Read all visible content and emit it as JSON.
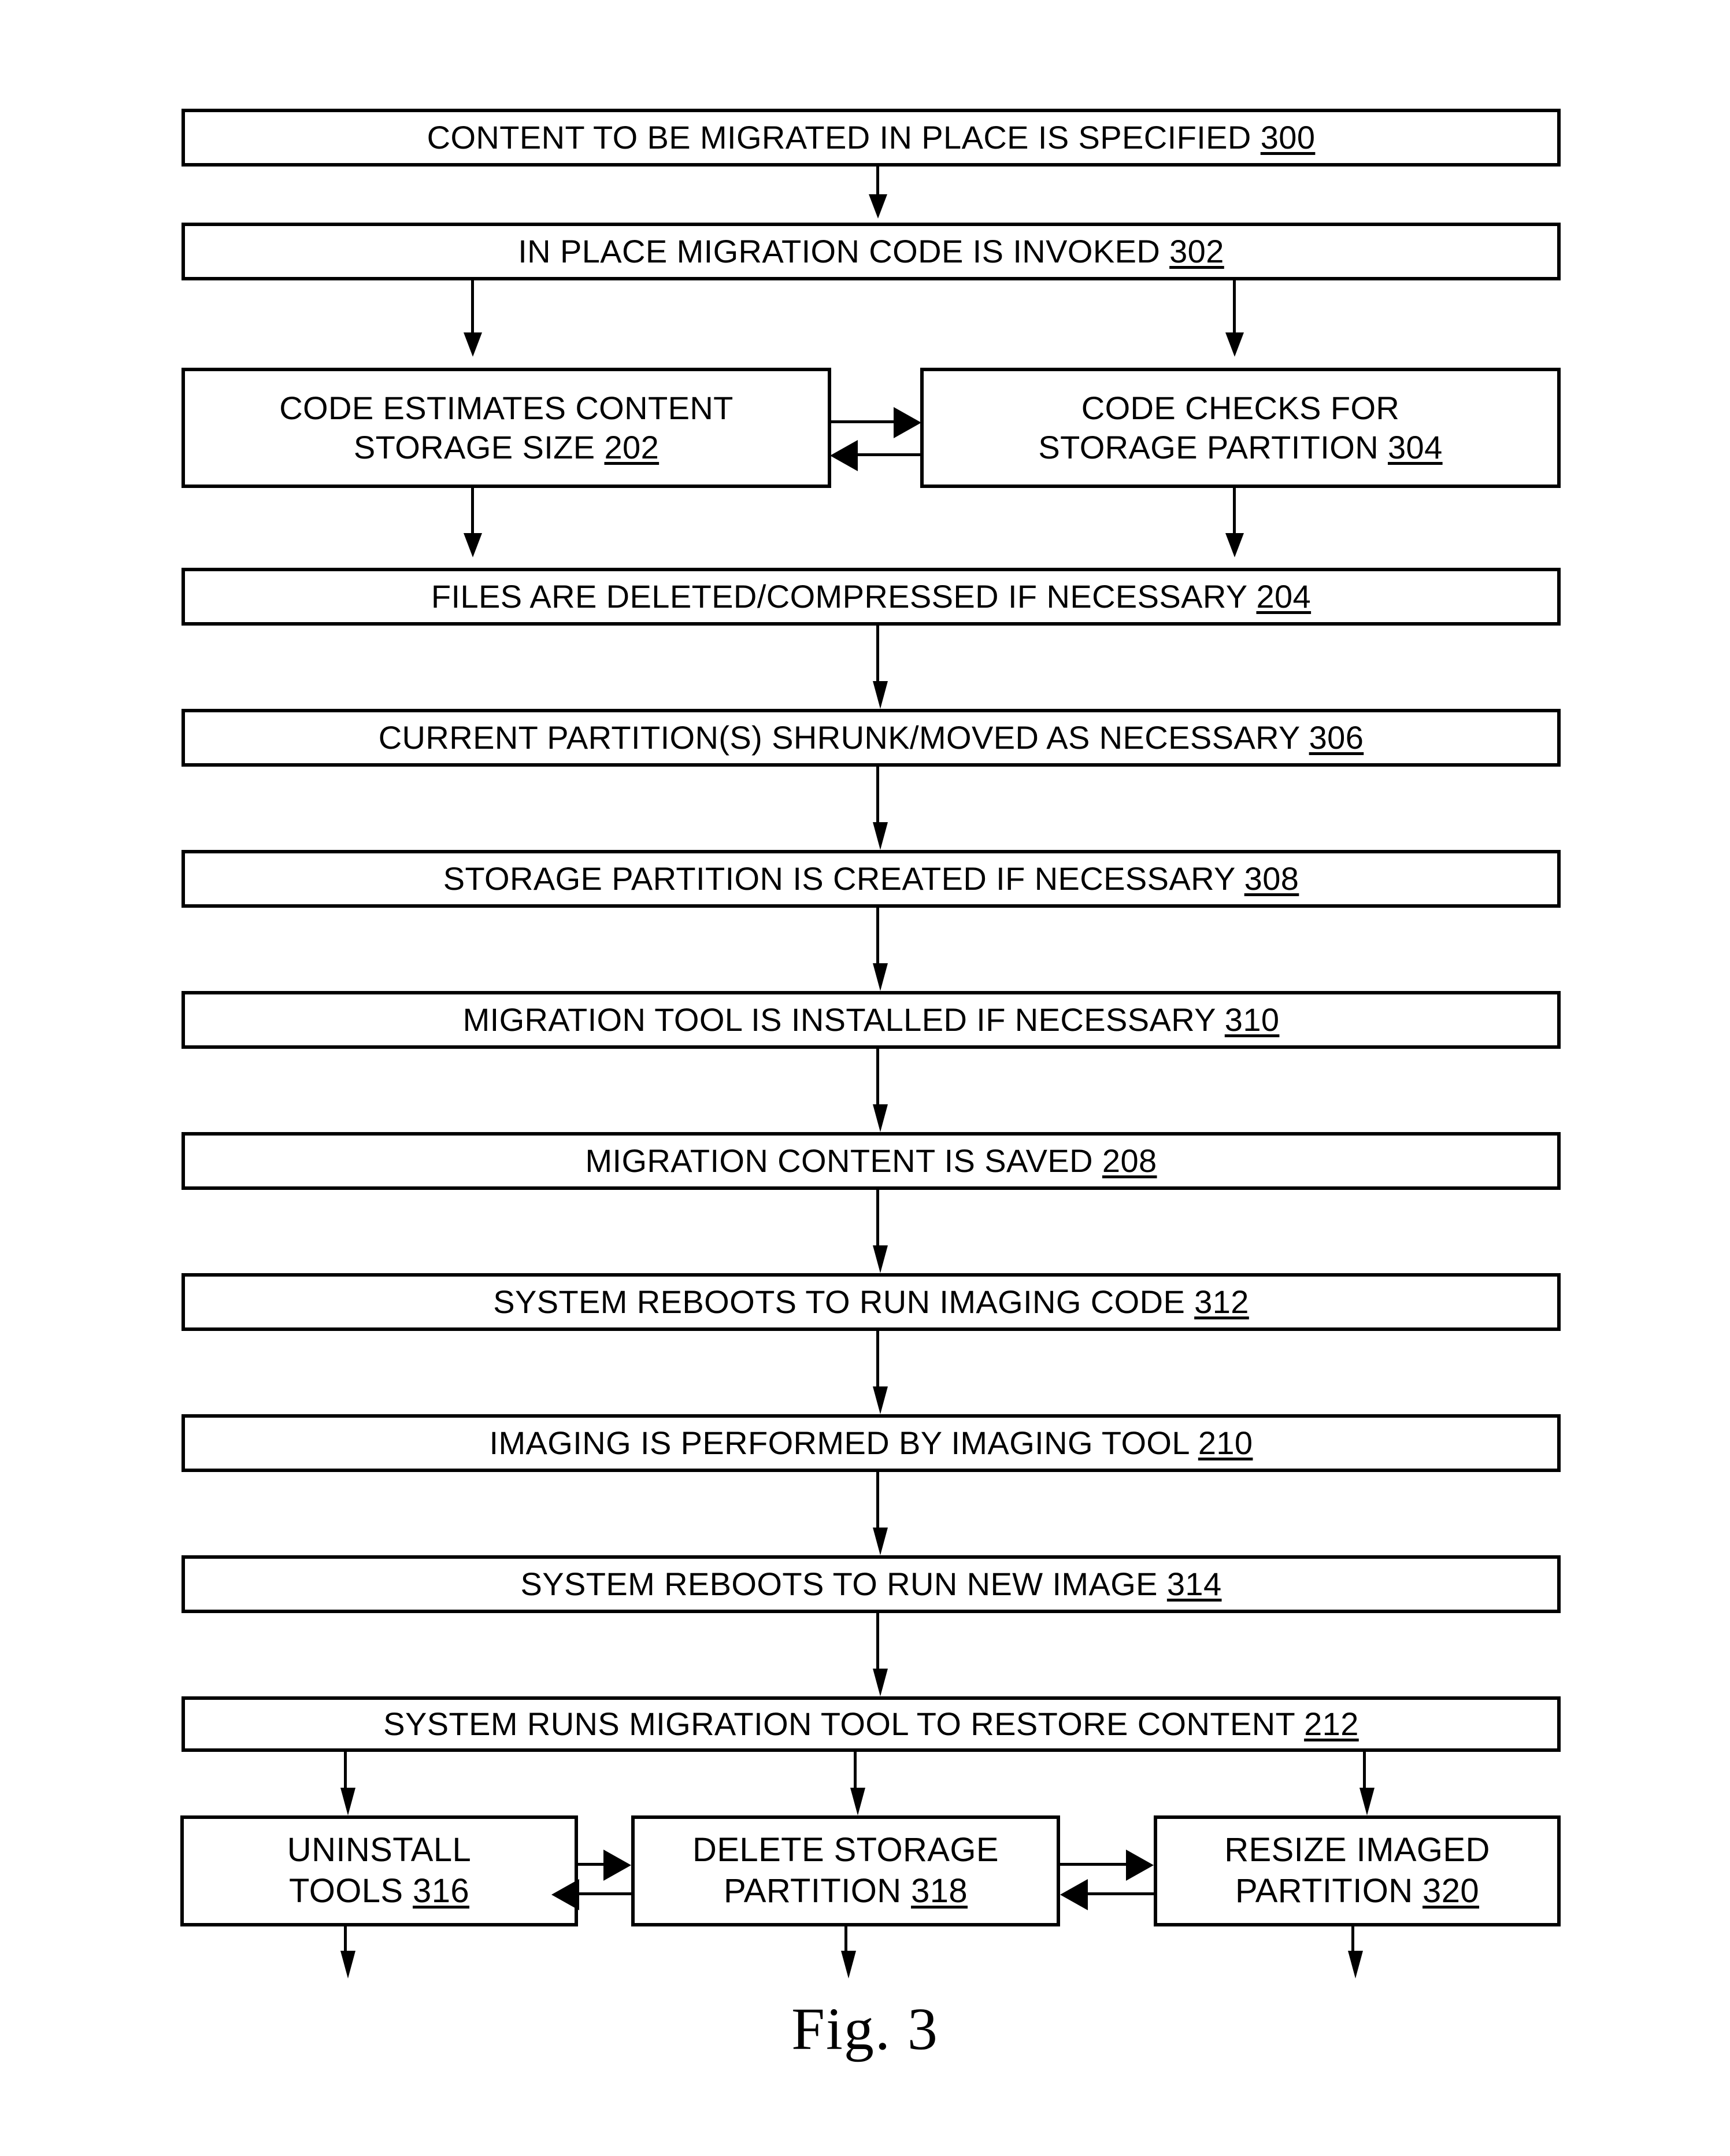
{
  "figure": {
    "caption": "Fig. 3",
    "title": "In place migration process flowchart"
  },
  "nodes": {
    "n300": {
      "text": "CONTENT TO BE MIGRATED IN PLACE IS SPECIFIED ",
      "ref": "300"
    },
    "n302": {
      "text": "IN PLACE MIGRATION CODE IS INVOKED ",
      "ref": "302"
    },
    "n202": {
      "text": "CODE ESTIMATES CONTENT\nSTORAGE SIZE ",
      "ref": "202"
    },
    "n304": {
      "text": "CODE CHECKS FOR\nSTORAGE PARTITION ",
      "ref": "304"
    },
    "n204": {
      "text": "FILES ARE DELETED/COMPRESSED IF NECESSARY ",
      "ref": "204"
    },
    "n306": {
      "text": "CURRENT PARTITION(S) SHRUNK/MOVED AS NECESSARY ",
      "ref": "306"
    },
    "n308": {
      "text": "STORAGE PARTITION IS CREATED IF NECESSARY ",
      "ref": "308"
    },
    "n310": {
      "text": "MIGRATION TOOL IS INSTALLED IF NECESSARY ",
      "ref": "310"
    },
    "n208": {
      "text": "MIGRATION CONTENT IS SAVED ",
      "ref": "208"
    },
    "n312": {
      "text": "SYSTEM REBOOTS TO RUN IMAGING CODE ",
      "ref": "312"
    },
    "n210": {
      "text": "IMAGING IS PERFORMED BY IMAGING TOOL ",
      "ref": "210"
    },
    "n314": {
      "text": "SYSTEM REBOOTS TO RUN NEW IMAGE ",
      "ref": "314"
    },
    "n212": {
      "text": "SYSTEM RUNS MIGRATION TOOL TO RESTORE CONTENT ",
      "ref": "212"
    },
    "n316": {
      "text": "UNINSTALL\nTOOLS ",
      "ref": "316"
    },
    "n318": {
      "text": "DELETE STORAGE\nPARTITION ",
      "ref": "318"
    },
    "n320": {
      "text": "RESIZE IMAGED\nPARTITION ",
      "ref": "320"
    }
  },
  "chart_data": {
    "type": "diagram",
    "title": "Fig. 3",
    "diagram_kind": "flowchart",
    "colors": {
      "line": "#000000",
      "fill": "#ffffff",
      "text": "#000000"
    },
    "steps": [
      {
        "id": "300",
        "label": "CONTENT TO BE MIGRATED IN PLACE IS SPECIFIED 300"
      },
      {
        "id": "302",
        "label": "IN PLACE MIGRATION CODE IS INVOKED 302"
      },
      {
        "id": "202",
        "label": "CODE ESTIMATES CONTENT STORAGE SIZE 202"
      },
      {
        "id": "304",
        "label": "CODE CHECKS FOR STORAGE PARTITION 304"
      },
      {
        "id": "204",
        "label": "FILES ARE DELETED/COMPRESSED IF NECESSARY 204"
      },
      {
        "id": "306",
        "label": "CURRENT PARTITION(S) SHRUNK/MOVED AS NECESSARY 306"
      },
      {
        "id": "308",
        "label": "STORAGE PARTITION IS CREATED IF NECESSARY 308"
      },
      {
        "id": "310",
        "label": "MIGRATION TOOL IS INSTALLED IF NECESSARY 310"
      },
      {
        "id": "208",
        "label": "MIGRATION CONTENT IS SAVED 208"
      },
      {
        "id": "312",
        "label": "SYSTEM REBOOTS TO RUN IMAGING CODE 312"
      },
      {
        "id": "210",
        "label": "IMAGING IS PERFORMED BY IMAGING TOOL 210"
      },
      {
        "id": "314",
        "label": "SYSTEM REBOOTS TO RUN NEW IMAGE 314"
      },
      {
        "id": "212",
        "label": "SYSTEM RUNS MIGRATION TOOL TO RESTORE CONTENT 212"
      },
      {
        "id": "316",
        "label": "UNINSTALL TOOLS 316"
      },
      {
        "id": "318",
        "label": "DELETE STORAGE PARTITION 318"
      },
      {
        "id": "320",
        "label": "RESIZE IMAGED PARTITION 320"
      }
    ],
    "edges": [
      {
        "from": "300",
        "to": "302",
        "type": "arrow"
      },
      {
        "from": "302",
        "to": "202",
        "type": "arrow"
      },
      {
        "from": "302",
        "to": "304",
        "type": "arrow"
      },
      {
        "from": "202",
        "to": "304",
        "type": "arrow"
      },
      {
        "from": "304",
        "to": "202",
        "type": "arrow"
      },
      {
        "from": "202",
        "to": "204",
        "type": "arrow"
      },
      {
        "from": "304",
        "to": "204",
        "type": "arrow"
      },
      {
        "from": "204",
        "to": "306",
        "type": "arrow"
      },
      {
        "from": "306",
        "to": "308",
        "type": "arrow"
      },
      {
        "from": "308",
        "to": "310",
        "type": "arrow"
      },
      {
        "from": "310",
        "to": "208",
        "type": "arrow"
      },
      {
        "from": "208",
        "to": "312",
        "type": "arrow"
      },
      {
        "from": "312",
        "to": "210",
        "type": "arrow"
      },
      {
        "from": "210",
        "to": "314",
        "type": "arrow"
      },
      {
        "from": "314",
        "to": "212",
        "type": "arrow"
      },
      {
        "from": "212",
        "to": "316",
        "type": "arrow"
      },
      {
        "from": "212",
        "to": "318",
        "type": "arrow"
      },
      {
        "from": "212",
        "to": "320",
        "type": "arrow"
      },
      {
        "from": "316",
        "to": "318",
        "type": "arrow"
      },
      {
        "from": "318",
        "to": "316",
        "type": "arrow"
      },
      {
        "from": "318",
        "to": "320",
        "type": "arrow"
      },
      {
        "from": "320",
        "to": "318",
        "type": "arrow"
      },
      {
        "from": "316",
        "to": "",
        "type": "arrow-out"
      },
      {
        "from": "318",
        "to": "",
        "type": "arrow-out"
      },
      {
        "from": "320",
        "to": "",
        "type": "arrow-out"
      }
    ]
  }
}
